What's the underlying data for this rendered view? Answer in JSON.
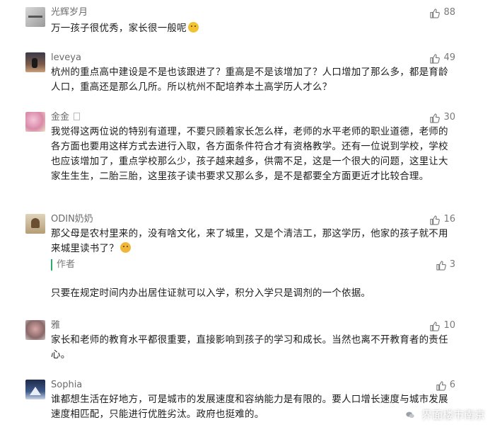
{
  "comments": [
    {
      "name": "光辉岁月",
      "likes": "88",
      "text": "万一孩子很优秀，家长很一般呢"
    },
    {
      "name": "leveya",
      "likes": "49",
      "text": "杭州的重点高中建设是不是也该跟进了？重高是不是该增加了？人口增加了那么多，都是育龄人口，重高还是那么几所。所以杭州不配培养本土高学历人才么？"
    },
    {
      "name": "金金",
      "likes": "30",
      "text": "我觉得这两位说的特别有道理，不要只顾着家长怎么样，老师的水平老师的职业道德，老师的各方面也要用这样方式去进行入取，各方面条件符合才有资格教学。还有一位说到学校，学校也应该增加了，重点学校那么少，孩子越来越多，供需不足，这是一个很大的问题，这里让大家生生生，二胎三胎，这里孩子读书要求又那么多，是不是都要全方面更近才比较合理。"
    },
    {
      "name": "ODIN奶奶",
      "likes": "16",
      "text": "那父母是农村里来的，没有啥文化，来了城里，又是个清洁工，那这学历，他家的孩子就不用来城里读书了？",
      "reply": {
        "label": "作者",
        "likes": "3",
        "text": "只要在规定时间内办出居住证就可以入学，积分入学只是调剂的一个依据。"
      }
    },
    {
      "name": "雅",
      "likes": "10",
      "text": "家长和老师的教育水平都很重要，直接影响到孩子的学习和成长。当然也离不开教育者的责任心。"
    },
    {
      "name": "Sophia",
      "likes": "6",
      "text": "谁都想生活在好地方，可是城市的发展速度和容纳能力是有限的。要人口增长速度与城市发展速度相匹配，只能进行优胜劣汰。政府也挺难的。"
    }
  ],
  "watermark": "界面楼市南京"
}
